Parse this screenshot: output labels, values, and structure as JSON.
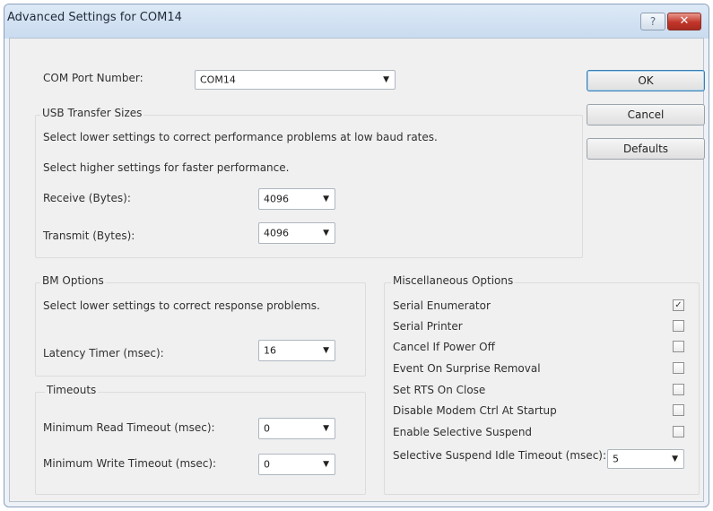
{
  "window": {
    "title": "Advanced Settings for COM14",
    "help_label": "?",
    "close_label": "✕"
  },
  "com_port": {
    "label": "COM Port Number:",
    "value": "COM14"
  },
  "buttons": {
    "ok": "OK",
    "cancel": "Cancel",
    "defaults": "Defaults"
  },
  "usb": {
    "title": "USB Transfer Sizes",
    "text1": "Select lower settings to correct performance problems at low baud rates.",
    "text2": "Select higher settings for faster performance.",
    "receive_label": "Receive (Bytes):",
    "receive_value": "4096",
    "transmit_label": "Transmit (Bytes):",
    "transmit_value": "4096"
  },
  "bm": {
    "title": "BM Options",
    "text": "Select lower settings to correct response problems.",
    "latency_label": "Latency Timer (msec):",
    "latency_value": "16"
  },
  "timeouts": {
    "title": "Timeouts",
    "read_label": "Minimum Read Timeout (msec):",
    "read_value": "0",
    "write_label": "Minimum Write Timeout (msec):",
    "write_value": "0"
  },
  "misc": {
    "title": "Miscellaneous Options",
    "options": [
      {
        "label": "Serial Enumerator",
        "checked": true
      },
      {
        "label": "Serial Printer",
        "checked": false
      },
      {
        "label": "Cancel If Power Off",
        "checked": false
      },
      {
        "label": "Event On Surprise Removal",
        "checked": false
      },
      {
        "label": "Set RTS On Close",
        "checked": false
      },
      {
        "label": "Disable Modem Ctrl At Startup",
        "checked": false
      },
      {
        "label": "Enable Selective Suspend",
        "checked": false
      }
    ],
    "idle_label": "Selective Suspend Idle Timeout (msec):",
    "idle_value": "5"
  },
  "glyphs": {
    "dropdown_arrow": "▼",
    "check_mark": "✓"
  },
  "colors": {
    "title_gradient_top": "#dde9f6",
    "close_red": "#c2352a",
    "dialog_bg": "#f0f0f0"
  }
}
